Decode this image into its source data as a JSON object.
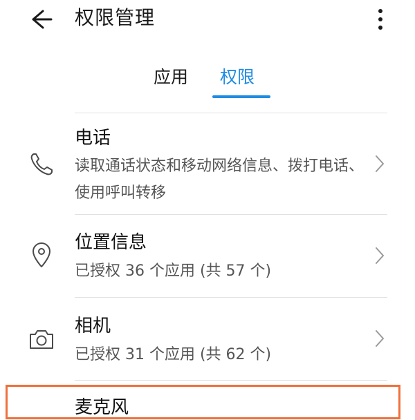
{
  "header": {
    "title": "权限管理"
  },
  "tabs": [
    {
      "label": "应用"
    },
    {
      "label": "权限"
    }
  ],
  "permissions": [
    {
      "title": "电话",
      "desc": "读取通话状态和移动网络信息、拨打电话、使用呼叫转移",
      "icon": "phone-icon"
    },
    {
      "title": "位置信息",
      "desc": "已授权 36 个应用 (共 57 个)",
      "icon": "location-pin-icon"
    },
    {
      "title": "相机",
      "desc": "已授权 31 个应用 (共 62 个)",
      "icon": "camera-icon"
    },
    {
      "title": "麦克风",
      "icon": "microphone-icon"
    }
  ],
  "colors": {
    "accent": "#1f8ce3",
    "highlight": "#f0703c"
  }
}
